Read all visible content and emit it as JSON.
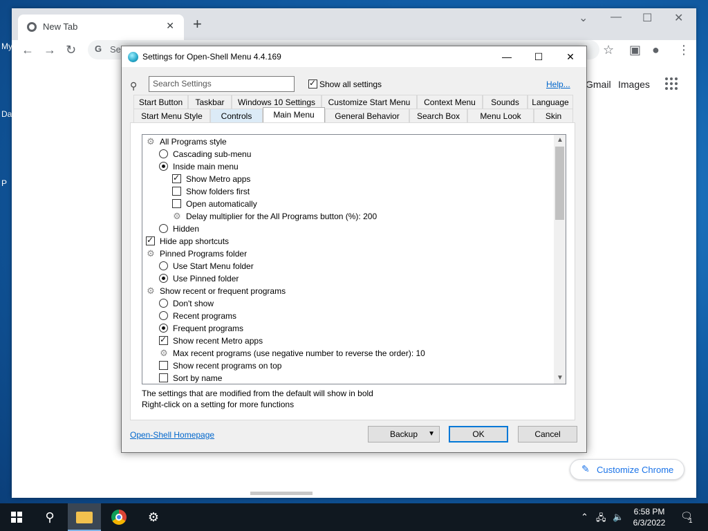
{
  "desktop": {
    "fragments": [
      "My",
      "Da",
      "P"
    ]
  },
  "chrome": {
    "tab_title": "New Tab",
    "omnibox_prefix": "G",
    "omnibox_text": "Se",
    "gmail": "Gmail",
    "images": "Images",
    "customize": "Customize Chrome"
  },
  "dialog": {
    "title": "Settings for Open-Shell Menu 4.4.169",
    "search_placeholder": "Search Settings",
    "show_all": "Show all settings",
    "help": "Help...",
    "tabs_row1": [
      "Start Button",
      "Taskbar",
      "Windows 10 Settings",
      "Customize Start Menu",
      "Context Menu",
      "Sounds",
      "Language"
    ],
    "tabs_row2": [
      "Start Menu Style",
      "Controls",
      "Main Menu",
      "General Behavior",
      "Search Box",
      "Menu Look",
      "Skin"
    ],
    "active_tab": "Main Menu",
    "tree": [
      {
        "type": "group",
        "label": "All Programs style"
      },
      {
        "type": "radio",
        "checked": false,
        "label": "Cascading sub-menu"
      },
      {
        "type": "radio",
        "checked": true,
        "label": "Inside main menu"
      },
      {
        "type": "check",
        "checked": true,
        "label": "Show Metro apps"
      },
      {
        "type": "check",
        "checked": false,
        "label": "Show folders first"
      },
      {
        "type": "check",
        "checked": false,
        "label": "Open automatically"
      },
      {
        "type": "value",
        "label": "Delay multiplier for the All Programs button (%): 200"
      },
      {
        "type": "radio",
        "checked": false,
        "label": "Hidden"
      },
      {
        "type": "check",
        "checked": true,
        "label": "Hide app shortcuts"
      },
      {
        "type": "group",
        "label": "Pinned Programs folder"
      },
      {
        "type": "radio",
        "checked": false,
        "label": "Use Start Menu folder"
      },
      {
        "type": "radio",
        "checked": true,
        "label": "Use Pinned folder"
      },
      {
        "type": "group",
        "label": "Show recent or frequent programs"
      },
      {
        "type": "radio",
        "checked": false,
        "label": "Don't show"
      },
      {
        "type": "radio",
        "checked": false,
        "label": "Recent programs"
      },
      {
        "type": "radio",
        "checked": true,
        "label": "Frequent programs"
      },
      {
        "type": "check",
        "checked": true,
        "label": "Show recent Metro apps"
      },
      {
        "type": "value",
        "label": "Max recent programs (use negative number to reverse the order): 10"
      },
      {
        "type": "check",
        "checked": false,
        "label": "Show recent programs on top"
      },
      {
        "type": "check",
        "checked": false,
        "label": "Sort by name"
      }
    ],
    "info_line1": "The settings that are modified from the default will show in bold",
    "info_line2": "Right-click on a setting for more functions",
    "homepage": "Open-Shell Homepage",
    "backup": "Backup",
    "ok": "OK",
    "cancel": "Cancel"
  },
  "taskbar": {
    "time": "6:58 PM",
    "date": "6/3/2022",
    "notifications": "1"
  }
}
